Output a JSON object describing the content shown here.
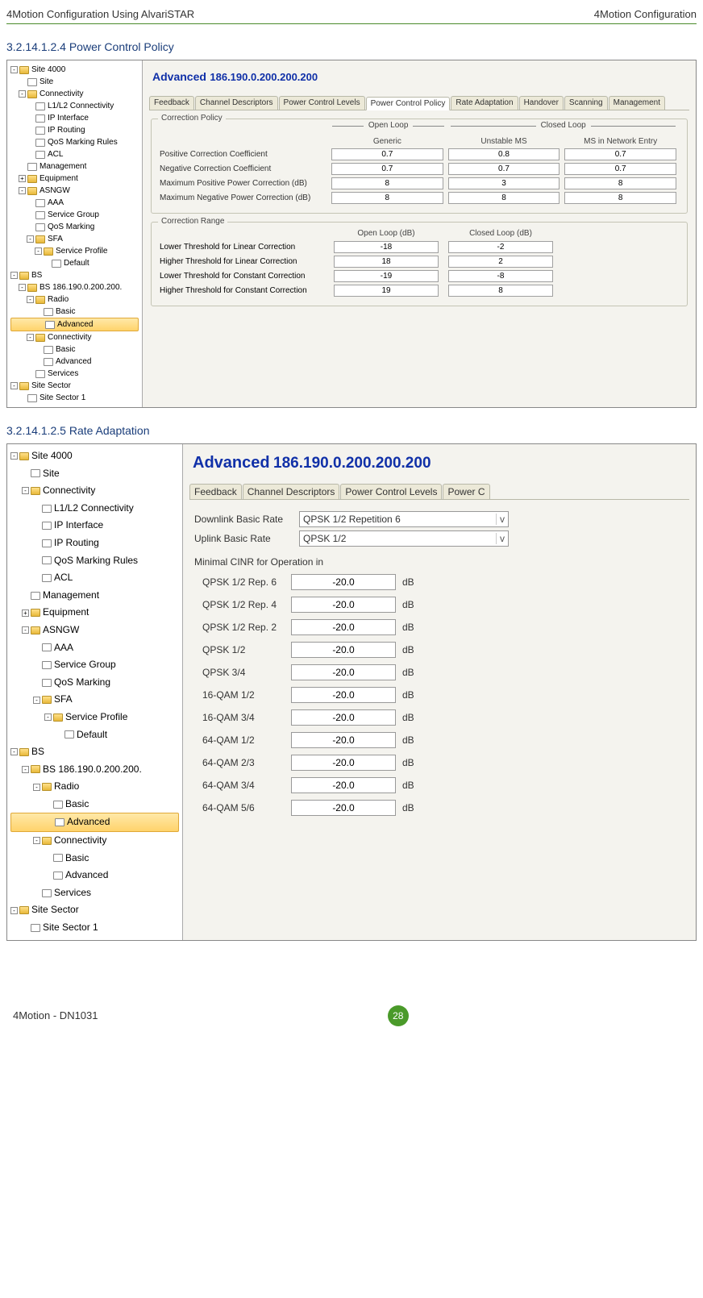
{
  "header": {
    "left": "4Motion Configuration Using AlvariSTAR",
    "right": "4Motion Configuration"
  },
  "sec1": {
    "num": "3.2.14.1.2.4",
    "title": "Power Control Policy"
  },
  "sec2": {
    "num": "3.2.14.1.2.5",
    "title": "Rate Adaptation"
  },
  "paneTitle": {
    "a": "Advanced",
    "b": "186.190.0.200.200.200"
  },
  "tabs1": [
    "Feedback",
    "Channel Descriptors",
    "Power Control Levels",
    "Power Control Policy",
    "Rate Adaptation",
    "Handover",
    "Scanning",
    "Management"
  ],
  "tabs2": [
    "Feedback",
    "Channel Descriptors",
    "Power Control Levels",
    "Power C"
  ],
  "tree1": [
    {
      "d": 0,
      "t": "fold",
      "x": "-",
      "l": "Site 4000"
    },
    {
      "d": 1,
      "t": "file",
      "l": "Site"
    },
    {
      "d": 1,
      "t": "fold",
      "x": "-",
      "l": "Connectivity"
    },
    {
      "d": 2,
      "t": "file",
      "l": "L1/L2 Connectivity"
    },
    {
      "d": 2,
      "t": "file",
      "l": "IP Interface"
    },
    {
      "d": 2,
      "t": "file",
      "l": "IP Routing"
    },
    {
      "d": 2,
      "t": "file",
      "l": "QoS Marking Rules"
    },
    {
      "d": 2,
      "t": "file",
      "l": "ACL"
    },
    {
      "d": 1,
      "t": "file",
      "l": "Management"
    },
    {
      "d": 1,
      "t": "fold",
      "x": "+",
      "l": "Equipment"
    },
    {
      "d": 1,
      "t": "fold",
      "x": "-",
      "l": "ASNGW"
    },
    {
      "d": 2,
      "t": "file",
      "l": "AAA"
    },
    {
      "d": 2,
      "t": "file",
      "l": "Service Group"
    },
    {
      "d": 2,
      "t": "file",
      "l": "QoS Marking"
    },
    {
      "d": 2,
      "t": "fold",
      "x": "-",
      "l": "SFA"
    },
    {
      "d": 3,
      "t": "fold",
      "x": "-",
      "l": "Service Profile"
    },
    {
      "d": 4,
      "t": "file",
      "l": "Default"
    },
    {
      "d": 0,
      "t": "fold",
      "x": "-",
      "l": "BS"
    },
    {
      "d": 1,
      "t": "fold",
      "x": "-",
      "l": "BS 186.190.0.200.200."
    },
    {
      "d": 2,
      "t": "fold",
      "x": "-",
      "l": "Radio"
    },
    {
      "d": 3,
      "t": "file",
      "l": "Basic"
    },
    {
      "d": 3,
      "t": "file",
      "l": "Advanced",
      "sel": true
    },
    {
      "d": 2,
      "t": "fold",
      "x": "-",
      "l": "Connectivity"
    },
    {
      "d": 3,
      "t": "file",
      "l": "Basic"
    },
    {
      "d": 3,
      "t": "file",
      "l": "Advanced"
    },
    {
      "d": 2,
      "t": "file",
      "l": "Services"
    },
    {
      "d": 0,
      "t": "fold",
      "x": "-",
      "l": "Site Sector"
    },
    {
      "d": 1,
      "t": "file",
      "l": "Site Sector 1"
    }
  ],
  "tree2": [
    {
      "d": 0,
      "t": "fold",
      "x": "-",
      "l": "Site 4000"
    },
    {
      "d": 1,
      "t": "file",
      "l": "Site"
    },
    {
      "d": 1,
      "t": "fold",
      "x": "-",
      "l": "Connectivity"
    },
    {
      "d": 2,
      "t": "file",
      "l": "L1/L2 Connectivity"
    },
    {
      "d": 2,
      "t": "file",
      "l": "IP Interface"
    },
    {
      "d": 2,
      "t": "file",
      "l": "IP Routing"
    },
    {
      "d": 2,
      "t": "file",
      "l": "QoS Marking Rules"
    },
    {
      "d": 2,
      "t": "file",
      "l": "ACL"
    },
    {
      "d": 1,
      "t": "file",
      "l": "Management"
    },
    {
      "d": 1,
      "t": "fold",
      "x": "+",
      "l": "Equipment"
    },
    {
      "d": 1,
      "t": "fold",
      "x": "-",
      "l": "ASNGW"
    },
    {
      "d": 2,
      "t": "file",
      "l": "AAA"
    },
    {
      "d": 2,
      "t": "file",
      "l": "Service Group"
    },
    {
      "d": 2,
      "t": "file",
      "l": "QoS Marking"
    },
    {
      "d": 2,
      "t": "fold",
      "x": "-",
      "l": "SFA"
    },
    {
      "d": 3,
      "t": "fold",
      "x": "-",
      "l": "Service Profile"
    },
    {
      "d": 4,
      "t": "file",
      "l": "Default"
    },
    {
      "d": 0,
      "t": "fold",
      "x": "-",
      "l": "BS"
    },
    {
      "d": 1,
      "t": "fold",
      "x": "-",
      "l": "BS 186.190.0.200.200."
    },
    {
      "d": 2,
      "t": "fold",
      "x": "-",
      "l": "Radio"
    },
    {
      "d": 3,
      "t": "file",
      "l": "Basic"
    },
    {
      "d": 3,
      "t": "file",
      "l": "Advanced",
      "sel": true
    },
    {
      "d": 2,
      "t": "fold",
      "x": "-",
      "l": "Connectivity"
    },
    {
      "d": 3,
      "t": "file",
      "l": "Basic"
    },
    {
      "d": 3,
      "t": "file",
      "l": "Advanced"
    },
    {
      "d": 2,
      "t": "file",
      "l": "Services"
    },
    {
      "d": 0,
      "t": "fold",
      "x": "-",
      "l": "Site Sector"
    },
    {
      "d": 1,
      "t": "file",
      "l": "Site Sector 1"
    }
  ],
  "correctionPolicy": {
    "legend": "Correction Policy",
    "grpOpen": "Open Loop",
    "grpClosed": "Closed Loop",
    "subGeneric": "Generic",
    "subUnstable": "Unstable MS",
    "subEntry": "MS in Network Entry",
    "rows": [
      {
        "l": "Positive Correction Coefficient",
        "v": [
          "0.7",
          "0.8",
          "0.7"
        ]
      },
      {
        "l": "Negative Correction Coefficient",
        "v": [
          "0.7",
          "0.7",
          "0.7"
        ]
      },
      {
        "l": "Maximum Positive Power Correction (dB)",
        "v": [
          "8",
          "3",
          "8"
        ]
      },
      {
        "l": "Maximum Negative Power Correction (dB)",
        "v": [
          "8",
          "8",
          "8"
        ]
      }
    ]
  },
  "correctionRange": {
    "legend": "Correction Range",
    "hOpen": "Open Loop (dB)",
    "hClosed": "Closed Loop (dB)",
    "rows": [
      {
        "l": "Lower Threshold for Linear Correction",
        "v": [
          "-18",
          "-2"
        ]
      },
      {
        "l": "Higher Threshold for Linear Correction",
        "v": [
          "18",
          "2"
        ]
      },
      {
        "l": "Lower Threshold for Constant Correction",
        "v": [
          "-19",
          "-8"
        ]
      },
      {
        "l": "Higher Threshold for Constant Correction",
        "v": [
          "19",
          "8"
        ]
      }
    ]
  },
  "rateAdapt": {
    "dlLabel": "Downlink Basic Rate",
    "dlVal": "QPSK 1/2 Repetition 6",
    "ulLabel": "Uplink Basic Rate",
    "ulVal": "QPSK 1/2",
    "groupLabel": "Minimal CINR for Operation in",
    "unit": "dB",
    "rows": [
      {
        "l": "QPSK 1/2 Rep. 6",
        "v": "-20.0"
      },
      {
        "l": "QPSK 1/2 Rep. 4",
        "v": "-20.0"
      },
      {
        "l": "QPSK 1/2 Rep. 2",
        "v": "-20.0"
      },
      {
        "l": "QPSK 1/2",
        "v": "-20.0"
      },
      {
        "l": "QPSK 3/4",
        "v": "-20.0"
      },
      {
        "l": "16-QAM 1/2",
        "v": "-20.0"
      },
      {
        "l": "16-QAM 3/4",
        "v": "-20.0"
      },
      {
        "l": "64-QAM 1/2",
        "v": "-20.0"
      },
      {
        "l": "64-QAM 2/3",
        "v": "-20.0"
      },
      {
        "l": "64-QAM 3/4",
        "v": "-20.0"
      },
      {
        "l": "64-QAM 5/6",
        "v": "-20.0"
      }
    ]
  },
  "footer": {
    "doc": "4Motion - DN1031",
    "page": "28"
  }
}
